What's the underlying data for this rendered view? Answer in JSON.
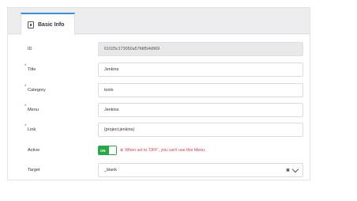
{
  "tab": {
    "label": "Basic Info",
    "icon": "info-card-icon"
  },
  "fields": {
    "id": {
      "label": "ID",
      "value": "61025c173050a57fd854d969"
    },
    "title": {
      "label": "Title",
      "value": "Jenkins",
      "required_mark": "*"
    },
    "category": {
      "label": "Category",
      "value": "tools",
      "required_mark": "*"
    },
    "menu": {
      "label": "Menu",
      "value": "Jenkins",
      "required_mark": "*"
    },
    "link": {
      "label": "Link",
      "value": "{project.jenkins}",
      "required_mark": "*"
    },
    "active": {
      "label": "Active",
      "toggle_text": "ON",
      "hint_icon": "⊗",
      "hint": "When set to 'OFF', you can't use this Menu."
    },
    "target": {
      "label": "Target",
      "value": "_blank",
      "clear_symbol": "✖"
    }
  },
  "colors": {
    "accent": "#3a8de0",
    "toggle_on": "#27a844",
    "required": "#e0353d"
  }
}
